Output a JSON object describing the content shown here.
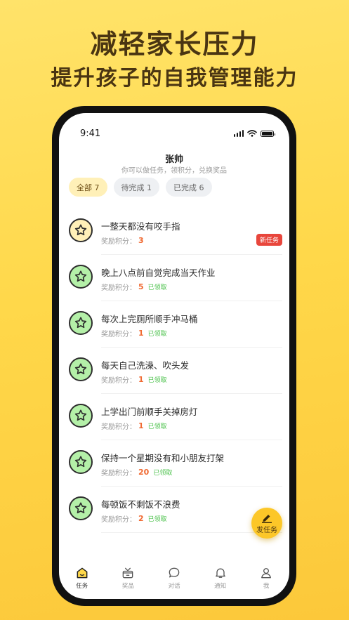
{
  "promo": {
    "headline": "减轻家长压力",
    "subline": "提升孩子的自我管理能力"
  },
  "status_bar": {
    "time": "9:41"
  },
  "header": {
    "name": "张帅",
    "subtitle": "你可以做任务，领积分，兑换奖品"
  },
  "filters": [
    {
      "label": "全部 7"
    },
    {
      "label": "待完成 1"
    },
    {
      "label": "已完成 6"
    }
  ],
  "reward_label": "奖励积分：",
  "tasks": [
    {
      "title": "一整天都没有咬手指",
      "points": "3",
      "status": "",
      "badge": "新任务"
    },
    {
      "title": "晚上八点前自觉完成当天作业",
      "points": "5",
      "status": "已领取"
    },
    {
      "title": "每次上完厕所顺手冲马桶",
      "points": "1",
      "status": "已领取"
    },
    {
      "title": "每天自己洗澡、吹头发",
      "points": "1",
      "status": "已领取"
    },
    {
      "title": "上学出门前顺手关掉房灯",
      "points": "1",
      "status": "已领取"
    },
    {
      "title": "保持一个星期没有和小朋友打架",
      "points": "20",
      "status": "已领取"
    },
    {
      "title": "每顿饭不剩饭不浪费",
      "points": "2",
      "status": "已领取"
    }
  ],
  "fab": {
    "label": "发任务",
    "icon": "pencil-icon"
  },
  "tabbar": [
    {
      "label": "任务",
      "icon": "home-icon"
    },
    {
      "label": "奖品",
      "icon": "gift-box-icon"
    },
    {
      "label": "对话",
      "icon": "chat-bubble-icon"
    },
    {
      "label": "通知",
      "icon": "bell-icon"
    },
    {
      "label": "我",
      "icon": "user-icon"
    }
  ],
  "colors": {
    "background": "#ffd84a",
    "accent": "#fcc728",
    "points": "#f06a32",
    "done_status": "#4cc24c",
    "new_badge": "#e8463c"
  }
}
